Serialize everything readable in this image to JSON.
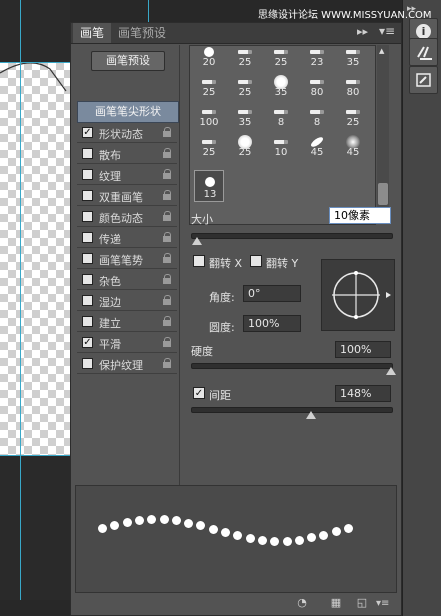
{
  "watermark": "思缘设计论坛 WWW.MISSYUAN.COM",
  "tabs": [
    "画笔",
    "画笔预设"
  ],
  "preset_button": "画笔预设",
  "tip_shape": "画笔笔尖形状",
  "options": [
    {
      "label": "形状动态",
      "checked": true,
      "lock": true
    },
    {
      "label": "散布",
      "checked": false,
      "lock": true
    },
    {
      "label": "纹理",
      "checked": false,
      "lock": true
    },
    {
      "label": "双重画笔",
      "checked": false,
      "lock": true
    },
    {
      "label": "颜色动态",
      "checked": false,
      "lock": true
    },
    {
      "label": "传递",
      "checked": false,
      "lock": true
    },
    {
      "label": "画笔笔势",
      "checked": false,
      "lock": true
    },
    {
      "label": "杂色",
      "checked": false,
      "lock": true
    },
    {
      "label": "湿边",
      "checked": false,
      "lock": true
    },
    {
      "label": "建立",
      "checked": false,
      "lock": true
    },
    {
      "label": "平滑",
      "checked": true,
      "lock": true
    },
    {
      "label": "保护纹理",
      "checked": false,
      "lock": true
    }
  ],
  "brushes": [
    {
      "size": "20",
      "icon": "small-dot"
    },
    {
      "size": "25",
      "icon": "pencil"
    },
    {
      "size": "25",
      "icon": "pencil"
    },
    {
      "size": "23",
      "icon": "pencil"
    },
    {
      "size": "35",
      "icon": "pencil"
    },
    {
      "size": "25",
      "icon": "pencil"
    },
    {
      "size": "25",
      "icon": "pencil"
    },
    {
      "size": "35",
      "icon": "round-hard"
    },
    {
      "size": "80",
      "icon": "pencil"
    },
    {
      "size": "80",
      "icon": "pencil"
    },
    {
      "size": "100",
      "icon": "pencil"
    },
    {
      "size": "35",
      "icon": "pencil"
    },
    {
      "size": "8",
      "icon": "pencil"
    },
    {
      "size": "8",
      "icon": "pencil"
    },
    {
      "size": "25",
      "icon": "pencil"
    },
    {
      "size": "25",
      "icon": "pencil"
    },
    {
      "size": "25",
      "icon": "round-hard"
    },
    {
      "size": "10",
      "icon": "pencil"
    },
    {
      "size": "45",
      "icon": "leaf"
    },
    {
      "size": "45",
      "icon": "round-soft"
    },
    {
      "size": "13",
      "icon": "small-dot",
      "selected": true
    }
  ],
  "size": {
    "label": "大小",
    "value": "10像素",
    "fraction": 0.03
  },
  "flip": {
    "x_label": "翻转 X",
    "y_label": "翻转 Y"
  },
  "angle": {
    "label": "角度:",
    "value": "0°"
  },
  "roundness": {
    "label": "圆度:",
    "value": "100%"
  },
  "hardness": {
    "label": "硬度",
    "value": "100%",
    "fraction": 1.0
  },
  "spacing": {
    "label": "间距",
    "value": "148%",
    "checked": true,
    "fraction": 0.6
  },
  "colors": {
    "panel": "#535353",
    "tab_active": "#535353",
    "tip_highlight": "#7a8a9e",
    "guide": "#39a8c8"
  }
}
